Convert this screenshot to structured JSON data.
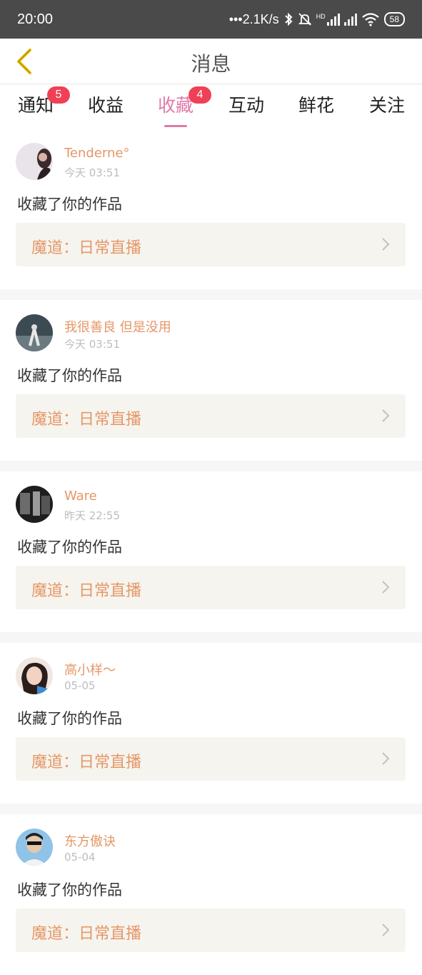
{
  "status_bar": {
    "time": "20:00",
    "network_speed": "•••2.1K/s",
    "hd_label": "HD",
    "battery": "58",
    "icons": [
      "bluetooth-icon",
      "mute-icon",
      "signal-icon",
      "wifi-icon",
      "battery-icon"
    ]
  },
  "header": {
    "back_icon": "chevron-left-icon",
    "title": "消息",
    "accent_color": "#e5b800"
  },
  "tabs": [
    {
      "label": "通知",
      "badge": "5",
      "active": false
    },
    {
      "label": "收益",
      "badge": "",
      "active": false
    },
    {
      "label": "收藏",
      "badge": "4",
      "active": true
    },
    {
      "label": "互动",
      "badge": "",
      "active": false
    },
    {
      "label": "鲜花",
      "badge": "",
      "active": false
    },
    {
      "label": "关注",
      "badge": "",
      "active": false
    }
  ],
  "colors": {
    "active_tab": "#e07aa8",
    "badge": "#ef4055",
    "username": "#e59768",
    "work_title": "#e59768"
  },
  "messages": [
    {
      "username": "Tenderne°",
      "time": "今天 03:51",
      "action": "收藏了你的作品",
      "work_title": "魔道：日常直播"
    },
    {
      "username": "我很善良 但是没用",
      "time": "今天 03:51",
      "action": "收藏了你的作品",
      "work_title": "魔道：日常直播"
    },
    {
      "username": "Ware",
      "time": "昨天 22:55",
      "action": "收藏了你的作品",
      "work_title": "魔道：日常直播"
    },
    {
      "username": "高小样〜",
      "time": "05-05",
      "action": "收藏了你的作品",
      "work_title": "魔道：日常直播"
    },
    {
      "username": "东方傲诀",
      "time": "05-04",
      "action": "收藏了你的作品",
      "work_title": "魔道：日常直播"
    }
  ]
}
